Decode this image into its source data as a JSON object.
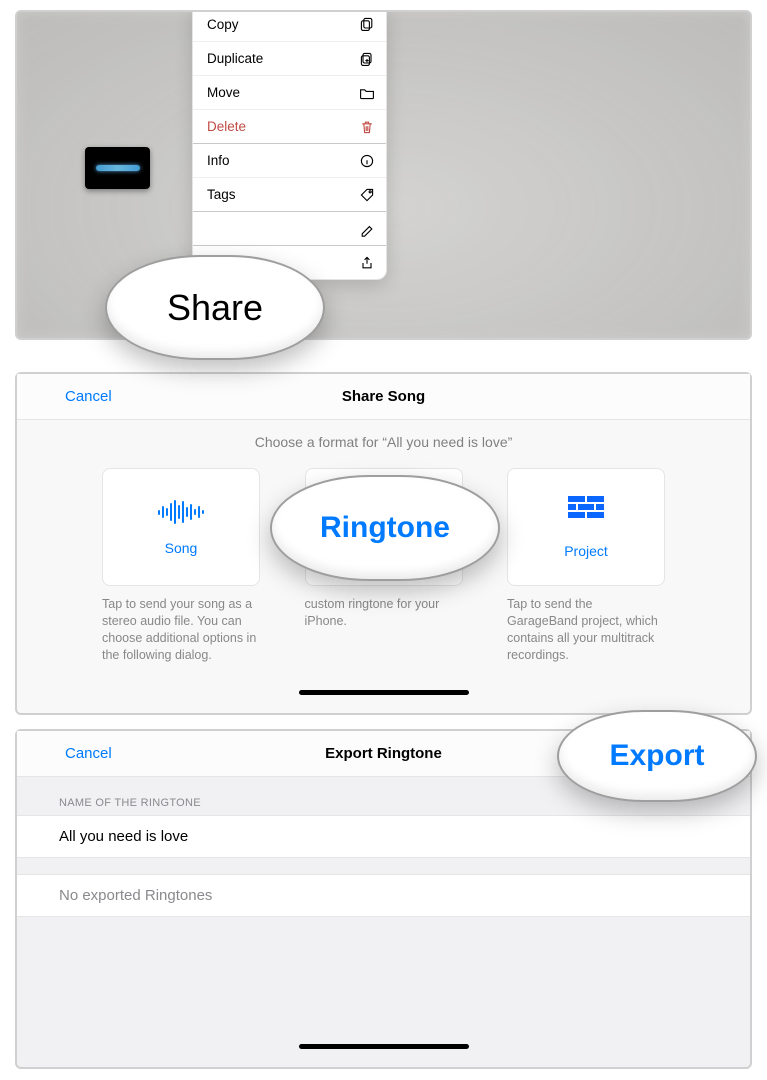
{
  "panel1": {
    "menu": {
      "copy": "Copy",
      "duplicate": "Duplicate",
      "move": "Move",
      "delete": "Delete",
      "info": "Info",
      "tags": "Tags"
    },
    "share_bubble": "Share"
  },
  "panel2": {
    "cancel": "Cancel",
    "title": "Share Song",
    "subtitle": "Choose a format for “All you need is love”",
    "cards": {
      "song": {
        "label": "Song",
        "desc": "Tap to send your song as a stereo audio file. You can choose additional options in the following dialog."
      },
      "ringtone": {
        "label": "Ringtone",
        "desc": "custom ringtone for your iPhone."
      },
      "project": {
        "label": "Project",
        "desc": "Tap to send the GarageBand project, which contains all your multitrack recordings."
      }
    },
    "ringtone_bubble": "Ringtone"
  },
  "panel3": {
    "cancel": "Cancel",
    "title": "Export Ringtone",
    "section_label": "NAME OF THE RINGTONE",
    "name_value": "All you need is love",
    "empty_list": "No exported Ringtones",
    "export_bubble": "Export"
  },
  "colors": {
    "accent": "#007aff",
    "danger": "#ff3b30"
  }
}
